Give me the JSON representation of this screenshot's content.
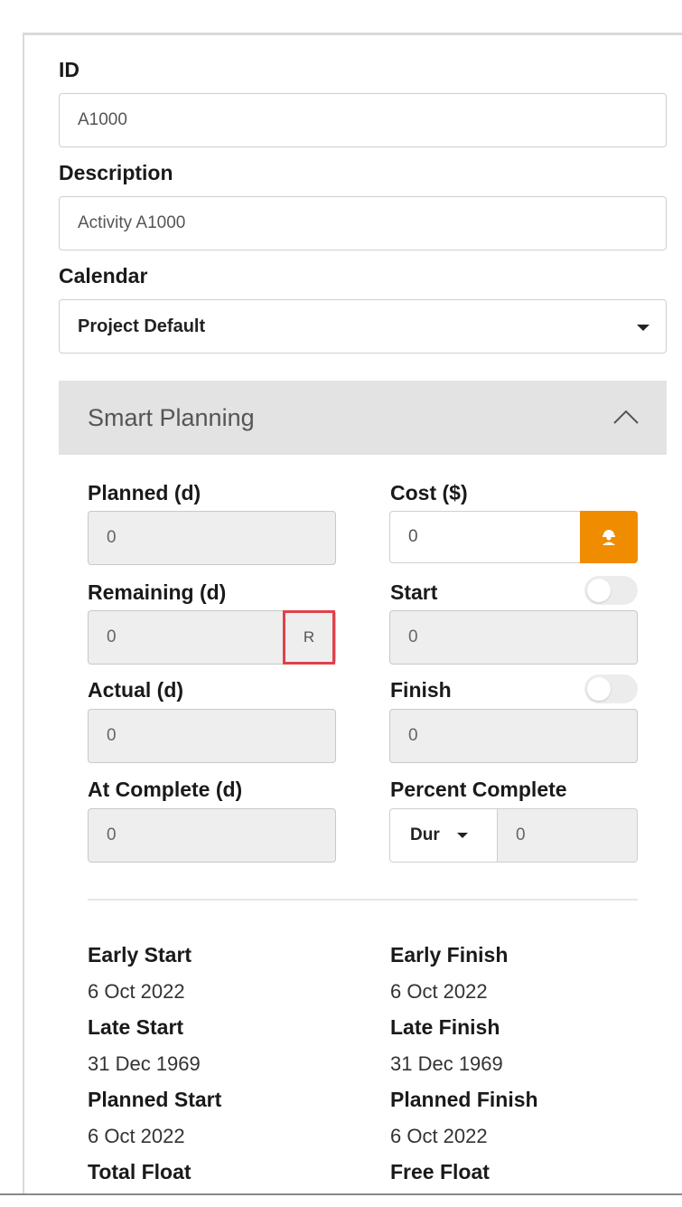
{
  "fields": {
    "id": {
      "label": "ID",
      "value": "A1000"
    },
    "description": {
      "label": "Description",
      "value": "Activity A1000"
    },
    "calendar": {
      "label": "Calendar",
      "value": "Project Default"
    }
  },
  "panel": {
    "title": "Smart Planning",
    "planned": {
      "label": "Planned (d)",
      "value": "0"
    },
    "cost": {
      "label": "Cost ($)",
      "value": "0",
      "button_icon": "person-icon"
    },
    "remaining": {
      "label": "Remaining (d)",
      "value": "0",
      "suffix": "R"
    },
    "start": {
      "label": "Start",
      "value": "0",
      "toggle_on": false
    },
    "actual": {
      "label": "Actual (d)",
      "value": "0"
    },
    "finish": {
      "label": "Finish",
      "value": "0",
      "toggle_on": false
    },
    "at_complete": {
      "label": "At Complete (d)",
      "value": "0"
    },
    "percent_complete": {
      "label": "Percent Complete",
      "type": "Dur",
      "value": "0"
    }
  },
  "dates": {
    "early_start": {
      "label": "Early Start",
      "value": "6 Oct 2022"
    },
    "early_finish": {
      "label": "Early Finish",
      "value": "6 Oct 2022"
    },
    "late_start": {
      "label": "Late Start",
      "value": "31 Dec 1969"
    },
    "late_finish": {
      "label": "Late Finish",
      "value": "31 Dec 1969"
    },
    "planned_start": {
      "label": "Planned Start",
      "value": "6 Oct 2022"
    },
    "planned_finish": {
      "label": "Planned Finish",
      "value": "6 Oct 2022"
    },
    "total_float": {
      "label": "Total Float"
    },
    "free_float": {
      "label": "Free Float"
    }
  },
  "colors": {
    "accent_orange": "#f08c00",
    "highlight_red": "#e0414a",
    "panel_header_bg": "#e3e3e3",
    "disabled_bg": "#eeeeee"
  }
}
